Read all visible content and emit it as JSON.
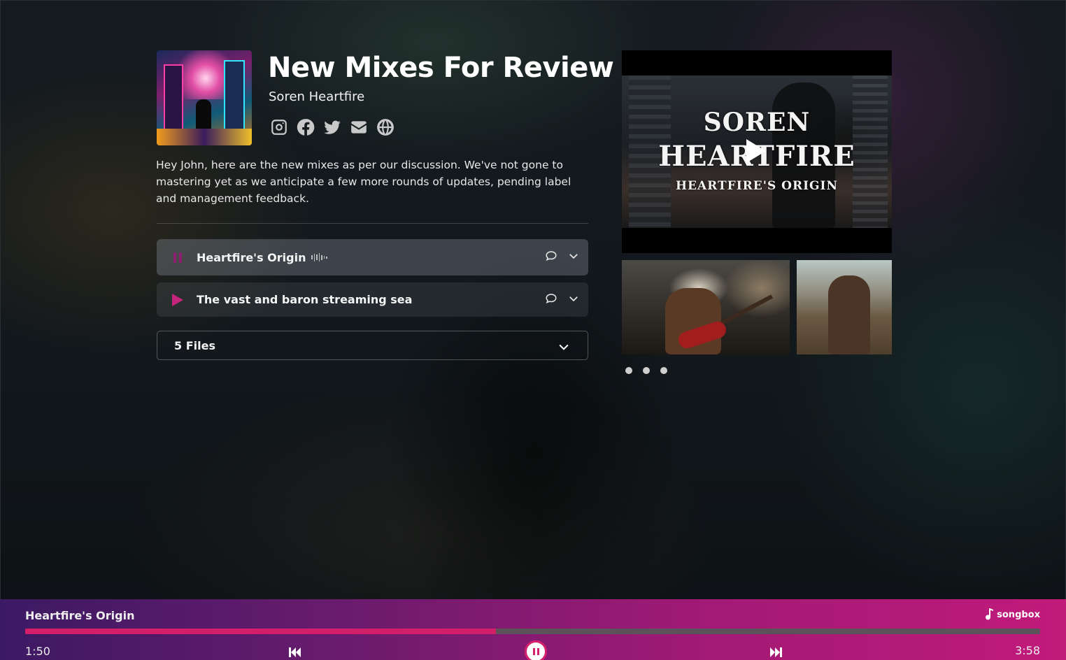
{
  "release": {
    "title": "New Mixes For Review",
    "artist": "Soren Heartfire",
    "description": "Hey John, here are the new mixes as per our discussion. We've not gone to mastering yet as we anticipate a few more rounds of updates, pending label and management feedback."
  },
  "socials": [
    "instagram-icon",
    "facebook-icon",
    "twitter-icon",
    "email-icon",
    "globe-icon"
  ],
  "tracks": [
    {
      "name": "Heartfire's Origin",
      "state": "playing"
    },
    {
      "name": "The vast and baron streaming sea",
      "state": "paused"
    }
  ],
  "files": {
    "label": "5 Files"
  },
  "video": {
    "line1": "SOREN",
    "line2": "HEARTFIRE",
    "line3": "HEARTFIRE'S ORIGIN"
  },
  "gallery": {
    "dots": 3
  },
  "player": {
    "title": "Heartfire's Origin",
    "brand": "songbox",
    "current": "1:50",
    "total": "3:58",
    "progress": 0.464
  },
  "colors": {
    "accent": "#d31f6a",
    "player_start": "#3c1a63",
    "player_end": "#c11a7b"
  }
}
